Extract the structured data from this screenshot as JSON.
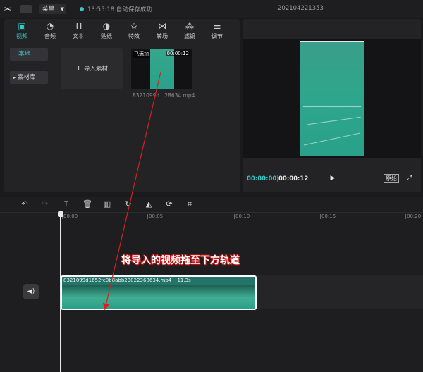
{
  "topbar": {
    "menu_label": "菜单",
    "save_time": "13:55:18",
    "save_status": "自动保存成功",
    "project_title": "202104221353",
    "status_color": "#35c8c5"
  },
  "media": {
    "tabs": [
      {
        "label": "视频",
        "icon": "video-icon",
        "active": true
      },
      {
        "label": "音频",
        "icon": "audio-icon"
      },
      {
        "label": "文本",
        "icon": "text-icon"
      },
      {
        "label": "贴纸",
        "icon": "sticker-icon"
      },
      {
        "label": "特效",
        "icon": "effects-icon"
      },
      {
        "label": "转场",
        "icon": "transition-icon"
      },
      {
        "label": "滤镜",
        "icon": "filter-icon"
      },
      {
        "label": "调节",
        "icon": "adjust-icon"
      }
    ],
    "side": {
      "local": "本地",
      "library": "素材库"
    },
    "import_label": "导入素材",
    "thumb": {
      "badge": "已添加",
      "duration": "00:00:12",
      "filename": "8321099d...28634.mp4"
    }
  },
  "preview": {
    "current_time": "00:00:00",
    "separator": "|",
    "total_time": "00:00:12",
    "ratio_label": "原始"
  },
  "timeline": {
    "ticks": [
      "00:00",
      "00:05",
      "00:10",
      "00:15",
      "00:20"
    ],
    "clip": {
      "name": "8321099d1652fc0b8abb23022368634.mp4",
      "duration": "11.3s"
    },
    "annotation": "将导入的视频拖至下方轨道",
    "accent": "#35c8c5",
    "annotation_color": "#d81e1e"
  }
}
